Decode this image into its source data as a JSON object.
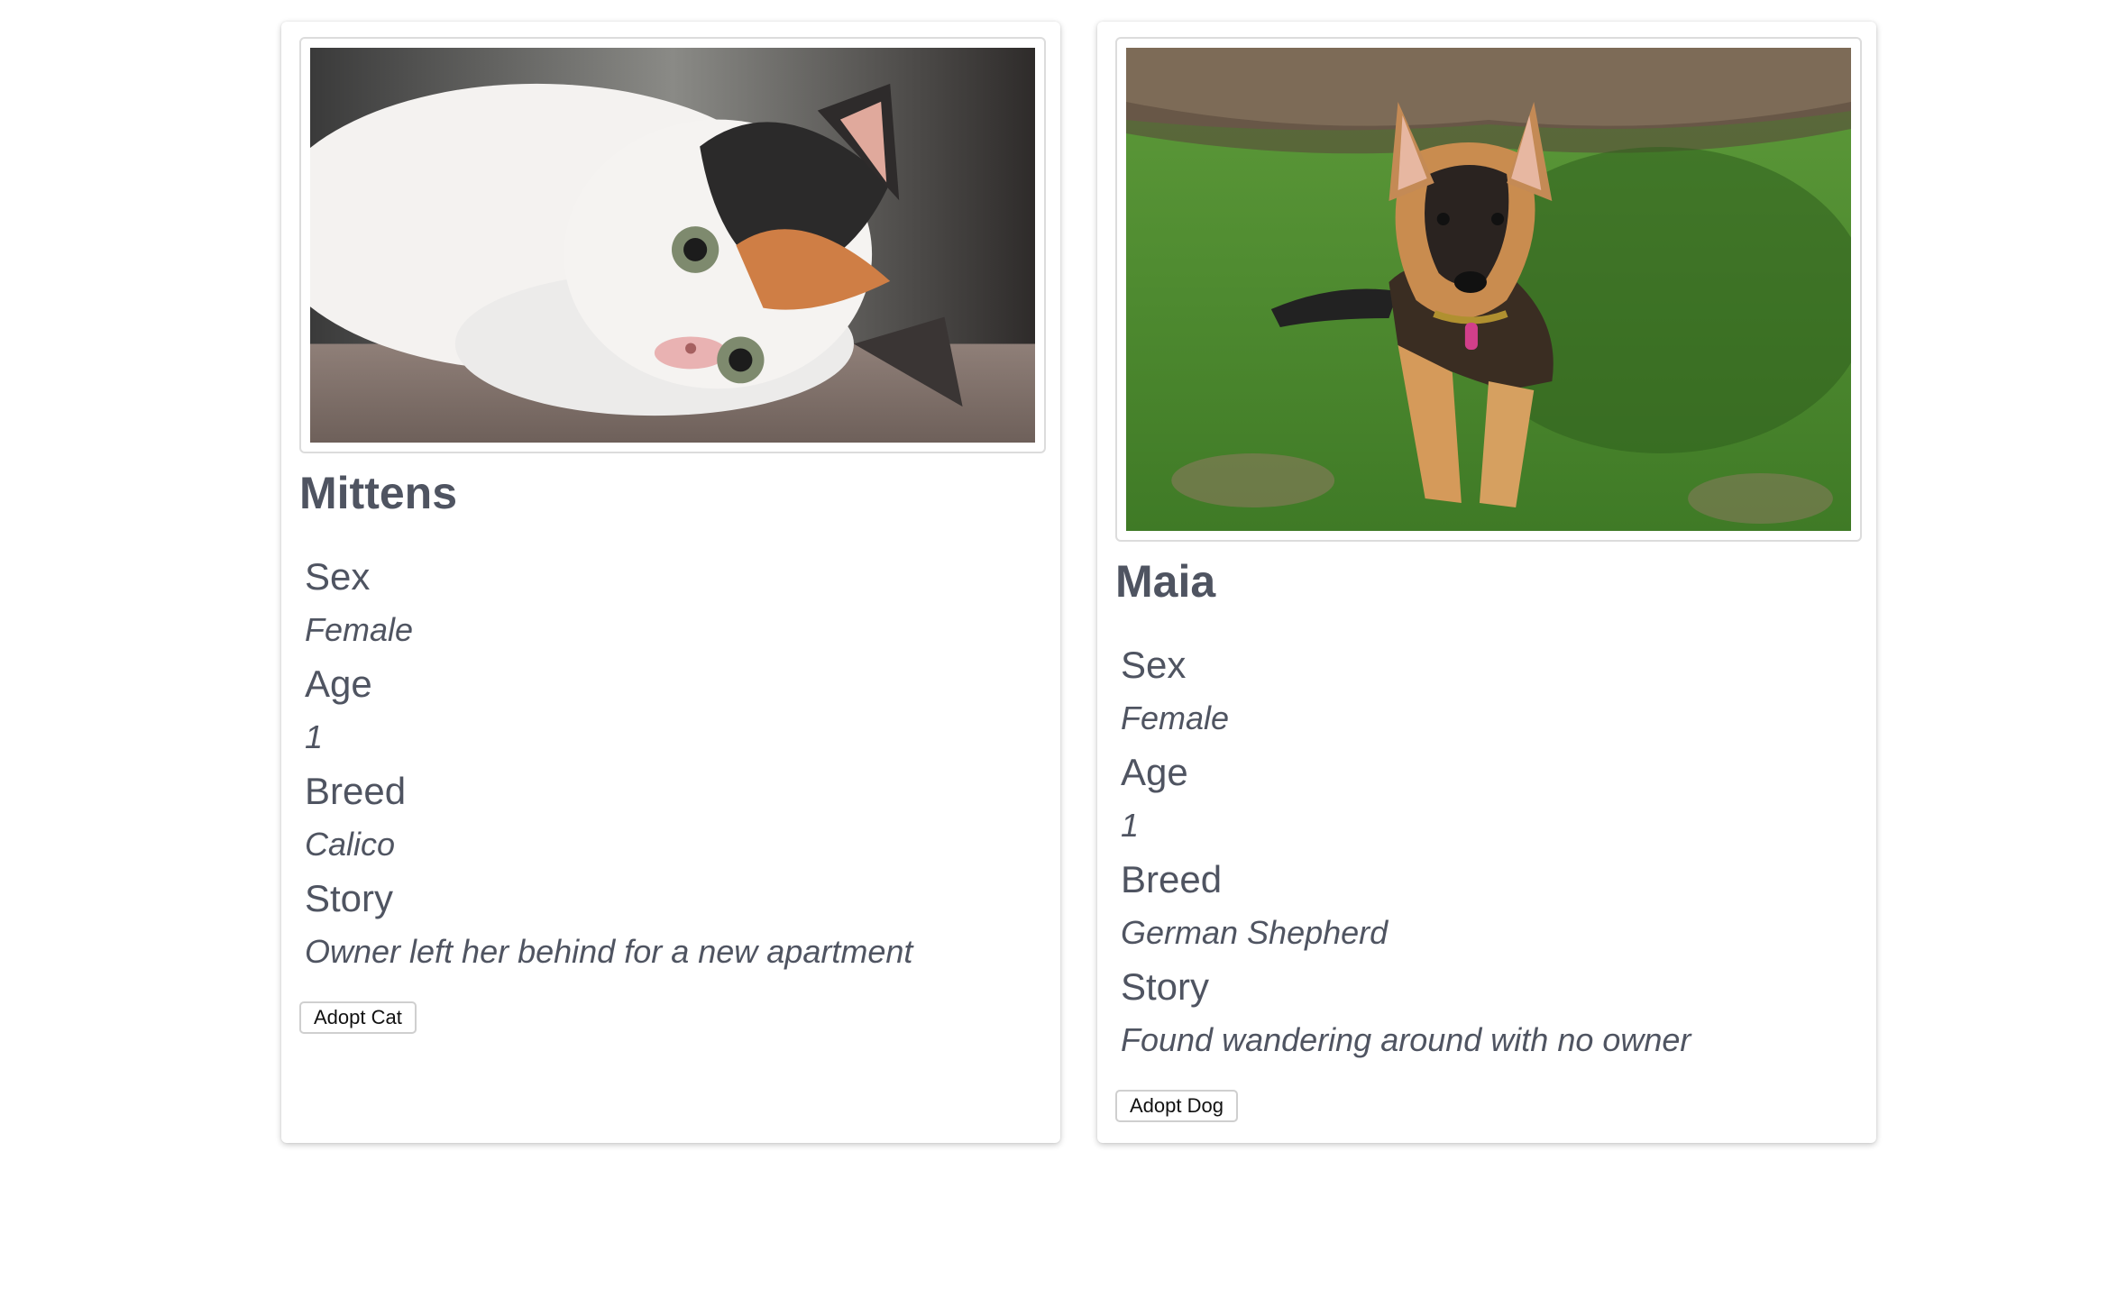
{
  "pets": [
    {
      "name": "Mittens",
      "photo_icon": "cat-photo",
      "sex_label": "Sex",
      "sex": "Female",
      "age_label": "Age",
      "age": "1",
      "breed_label": "Breed",
      "breed": "Calico",
      "story_label": "Story",
      "story": "Owner left her behind for a new apartment",
      "adopt_label": "Adopt Cat"
    },
    {
      "name": "Maia",
      "photo_icon": "dog-photo",
      "sex_label": "Sex",
      "sex": "Female",
      "age_label": "Age",
      "age": "1",
      "breed_label": "Breed",
      "breed": "German Shepherd",
      "story_label": "Story",
      "story": "Found wandering around with no owner",
      "adopt_label": "Adopt Dog"
    }
  ],
  "colors": {
    "text": "#4f5461",
    "card_bg": "#ffffff",
    "frame_border": "#dcdcdc",
    "button_border": "#cfcfcf"
  }
}
